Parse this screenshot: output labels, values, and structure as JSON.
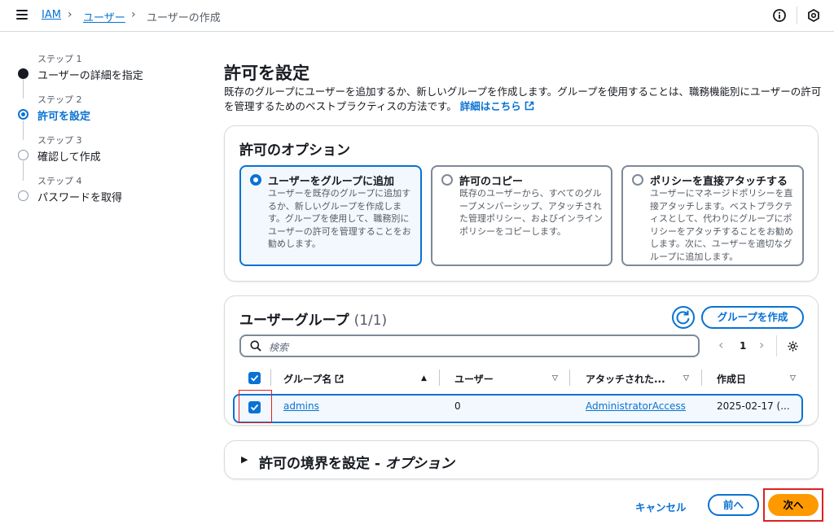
{
  "breadcrumb": {
    "root": "IAM",
    "users": "ユーザー",
    "current": "ユーザーの作成"
  },
  "steps": [
    {
      "num": "ステップ 1",
      "label": "ユーザーの詳細を指定"
    },
    {
      "num": "ステップ 2",
      "label": "許可を設定"
    },
    {
      "num": "ステップ 3",
      "label": "確認して作成"
    },
    {
      "num": "ステップ 4",
      "label": "パスワードを取得"
    }
  ],
  "page": {
    "title": "許可を設定",
    "description": "既存のグループにユーザーを追加するか、新しいグループを作成します。グループを使用することは、職務機能別にユーザーの許可を管理するためのベストプラクティスの方法です。",
    "learn_more": "詳細はこちら"
  },
  "options": {
    "title": "許可のオプション",
    "items": [
      {
        "title": "ユーザーをグループに追加",
        "desc": "ユーザーを既存のグループに追加するか、新しいグループを作成します。グループを使用して、職務別にユーザーの許可を管理することをお勧めします。",
        "selected": true
      },
      {
        "title": "許可のコピー",
        "desc": "既存のユーザーから、すべてのグループメンバーシップ、アタッチされた管理ポリシー、およびインラインポリシーをコピーします。",
        "selected": false
      },
      {
        "title": "ポリシーを直接アタッチする",
        "desc": "ユーザーにマネージドポリシーを直接アタッチします。ベストプラクティスとして、代わりにグループにポリシーをアタッチすることをお勧めします。次に、ユーザーを適切なグループに追加します。",
        "selected": false
      }
    ]
  },
  "groups": {
    "title": "ユーザーグループ",
    "count": "(1/1)",
    "create_button": "グループを作成",
    "search_placeholder": "検索",
    "page_number": "1",
    "columns": [
      "グループ名",
      "ユーザー",
      "アタッチされた...",
      "作成日"
    ],
    "rows": [
      {
        "name": "admins",
        "users": "0",
        "policy": "AdministratorAccess",
        "created": "2025-02-17 (...",
        "checked": true
      }
    ]
  },
  "boundary": {
    "title": "許可の境界を設定 - ",
    "title_optional": "オプション"
  },
  "footer": {
    "cancel": "キャンセル",
    "prev": "前へ",
    "next": "次へ"
  },
  "colors": {
    "accent": "#0972d3",
    "primary_button": "#ff9900",
    "highlight": "#e02020"
  }
}
